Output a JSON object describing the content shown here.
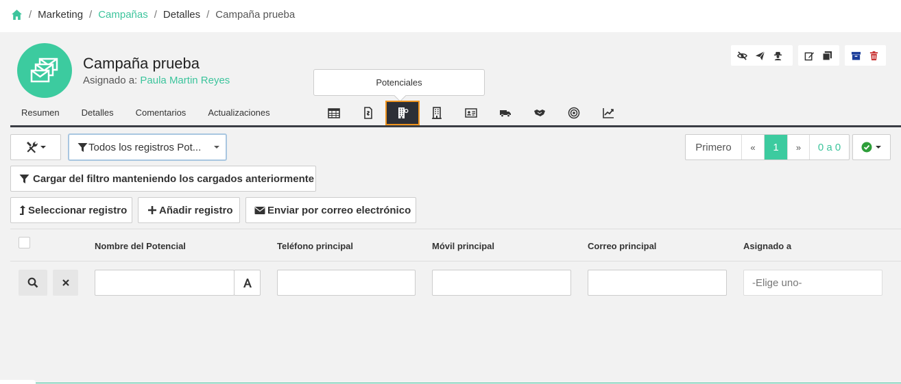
{
  "breadcrumb": {
    "home_icon": "home-icon",
    "items": [
      "Marketing",
      "Campañas",
      "Detalles",
      "Campaña prueba"
    ],
    "separator": "/"
  },
  "record": {
    "title": "Campaña prueba",
    "assigned_label": "Asignado a:",
    "assigned_user": "Paula Martin Reyes",
    "avatar_icon": "envelopes-icon"
  },
  "actions": {
    "group1": [
      "eye-slash-icon",
      "paper-plane-icon",
      "user-secret-icon"
    ],
    "group2": [
      "edit-icon",
      "copy-icon"
    ],
    "group3": [
      "archive-icon",
      "trash-icon"
    ]
  },
  "tabs": [
    "Resumen",
    "Detalles",
    "Comentarios",
    "Actualizaciones"
  ],
  "tooltip": "Potenciales",
  "subtabs": [
    "calendar-icon",
    "file-invoice-icon",
    "lead-building-icon",
    "building-icon",
    "id-card-icon",
    "truck-icon",
    "handshake-icon",
    "bullseye-icon",
    "chart-line-icon"
  ],
  "toolbar": {
    "tools_icon": "tools-icon",
    "filter_select": "Todos los registros Pot...",
    "load_filter": "Cargar del filtro manteniendo los cargados anteriormente",
    "select_record": "Seleccionar registro",
    "add_record": "Añadir registro",
    "send_email": "Enviar por correo electrónico"
  },
  "pager": {
    "first": "Primero",
    "prev": "«",
    "current": "1",
    "next": "»",
    "range": "0 a 0"
  },
  "table": {
    "columns": [
      "Nombre del Potencial",
      "Teléfono principal",
      "Móvil principal",
      "Correo principal",
      "Asignado a"
    ],
    "assigned_placeholder": "-Elige uno-"
  },
  "colors": {
    "accent": "#3cc49c",
    "dark_bar": "#3a3d44",
    "active_outline": "#f0941e",
    "archive": "#1a3d9a",
    "trash": "#c62828",
    "status_check": "#2e9e3a"
  }
}
